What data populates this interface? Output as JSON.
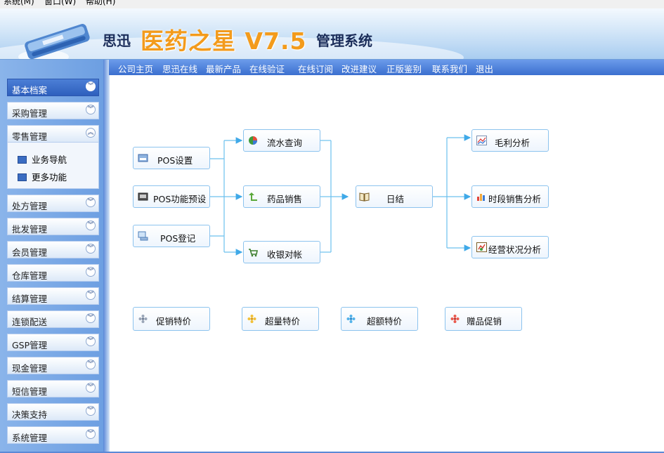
{
  "menubar": {
    "items": [
      "系统(M)",
      "窗口(W)",
      "帮助(H)"
    ]
  },
  "header": {
    "brand": "思迅",
    "product": "医药之星 V7.5",
    "suffix": "管理系统"
  },
  "nav": {
    "links": [
      "公司主页",
      "思迅在线",
      "最新产品",
      "在线验证",
      "在线订阅",
      "改进建议",
      "正版鉴别",
      "联系我们",
      "退出"
    ]
  },
  "sidebar": {
    "groups": [
      {
        "label": "基本档案",
        "state": "active"
      },
      {
        "label": "采购管理"
      },
      {
        "label": "零售管理",
        "state": "expanded"
      }
    ],
    "sub_items": [
      "业务导航",
      "更多功能"
    ],
    "groups_after": [
      "处方管理",
      "批发管理",
      "会员管理",
      "仓库管理",
      "结算管理",
      "连锁配送",
      "GSP管理",
      "现金管理",
      "短信管理",
      "决策支持",
      "系统管理"
    ]
  },
  "flow": {
    "left": [
      "POS设置",
      "POS功能预设",
      "POS登记"
    ],
    "middle": [
      "流水查询",
      "药品销售",
      "收银对帐"
    ],
    "center": "日结",
    "right": [
      "毛利分析",
      "时段销售分析",
      "经营状况分析"
    ],
    "promos": [
      "促销特价",
      "超量特价",
      "超额特价",
      "赠品促销"
    ]
  },
  "colors": {
    "accent": "#3b6fcf",
    "sidebar": "#7aa8e6",
    "line": "#6cc0ee",
    "title_orange": "#f39b1c"
  }
}
